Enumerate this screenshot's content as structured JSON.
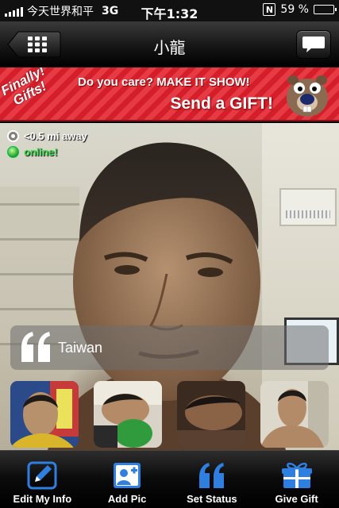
{
  "status_bar": {
    "carrier": "今天世界和平",
    "network": "3G",
    "time": "下午1:32",
    "battery_text": "59 %",
    "battery_level": 0.59,
    "notification_badge": "N"
  },
  "nav": {
    "title": "小龍",
    "back_icon": "grid-icon",
    "message_icon": "chat-bubble-icon"
  },
  "banner": {
    "badge_line1": "Finally!",
    "badge_line2": "Gifts!",
    "line1": "Do you care? MAKE IT SHOW!",
    "line2": "Send a GIFT!"
  },
  "profile": {
    "distance": "<0.5 mi away",
    "status": "online!",
    "quote": "Taiwan",
    "thumbnails": [
      "thumb-1",
      "thumb-2",
      "thumb-3",
      "thumb-4"
    ]
  },
  "tabbar": {
    "items": [
      {
        "label": "Edit My Info",
        "icon": "pencil-icon"
      },
      {
        "label": "Add Pic",
        "icon": "add-photo-icon"
      },
      {
        "label": "Set Status",
        "icon": "quote-icon"
      },
      {
        "label": "Give Gift",
        "icon": "gift-icon"
      }
    ]
  },
  "colors": {
    "banner_red": "#d41f2b",
    "online_green": "#3fe04f",
    "tab_icon_blue": "#2f7fe0"
  }
}
